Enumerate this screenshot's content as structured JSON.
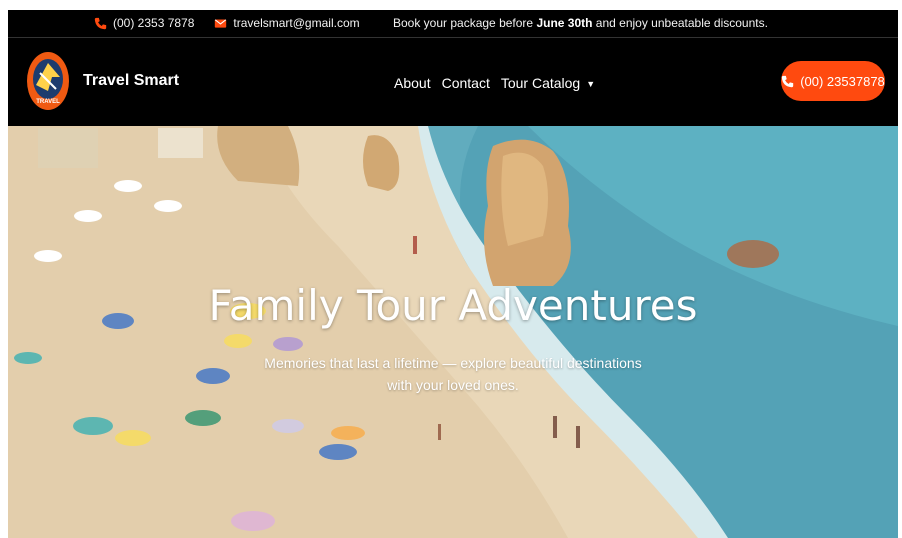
{
  "topbar": {
    "phone": "(00) 2353 7878",
    "email": "travelsmart@gmail.com",
    "promo_before": "Book your package before",
    "promo_date": "June 30th",
    "promo_after": "and enjoy unbeatable discounts."
  },
  "navbar": {
    "brand": "Travel Smart",
    "logo_text": "TRAVEL",
    "links": [
      "About",
      "Contact",
      "Tour Catalog"
    ],
    "call_button": "(00) 23537878"
  },
  "hero": {
    "title": "Family Tour Adventures",
    "subtitle": "Memories that last a lifetime — explore beautiful destinations with your loved ones."
  },
  "colors": {
    "accent": "#ff4a0f",
    "bar_bg": "#000000"
  },
  "icons": [
    "phone-icon",
    "mail-icon",
    "chevron-down-icon"
  ]
}
